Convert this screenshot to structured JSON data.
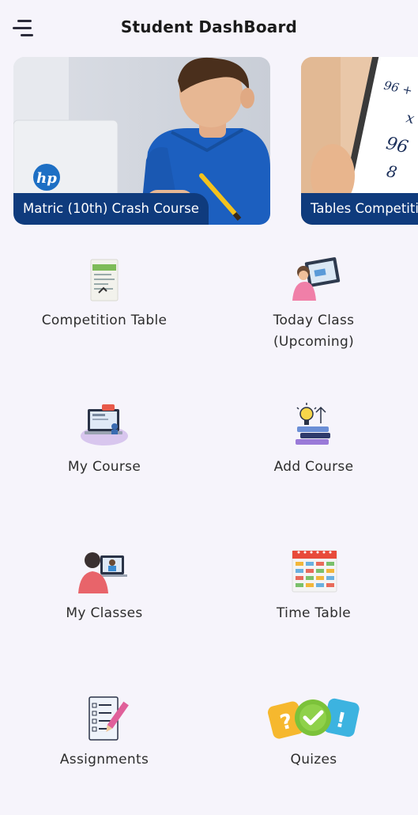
{
  "header": {
    "title": "Student DashBoard",
    "menu_icon": "hamburger-menu-icon"
  },
  "banners": [
    {
      "caption": "Matric (10th) Crash Course",
      "logo_text": "hp"
    },
    {
      "caption": "Tables Competition",
      "sheet_lines": [
        "96 +",
        "x",
        "96",
        "8"
      ]
    }
  ],
  "menu_items": [
    {
      "label": "Competition Table",
      "icon": "competition-sheet-icon"
    },
    {
      "label": "Today Class (Upcoming)",
      "line1": "Today Class",
      "line2": "(Upcoming)",
      "icon": "teacher-board-icon"
    },
    {
      "label": "My Course",
      "icon": "laptop-course-icon"
    },
    {
      "label": "Add Course",
      "icon": "idea-books-icon"
    },
    {
      "label": "My Classes",
      "icon": "online-class-icon"
    },
    {
      "label": "Time Table",
      "icon": "calendar-timetable-icon"
    },
    {
      "label": "Assignments",
      "icon": "checklist-pencil-icon"
    },
    {
      "label": "Quizes",
      "icon": "quiz-question-check-icon"
    }
  ],
  "colors": {
    "banner_caption_bg": "#0f3b7d",
    "background": "#f6f4fb"
  }
}
